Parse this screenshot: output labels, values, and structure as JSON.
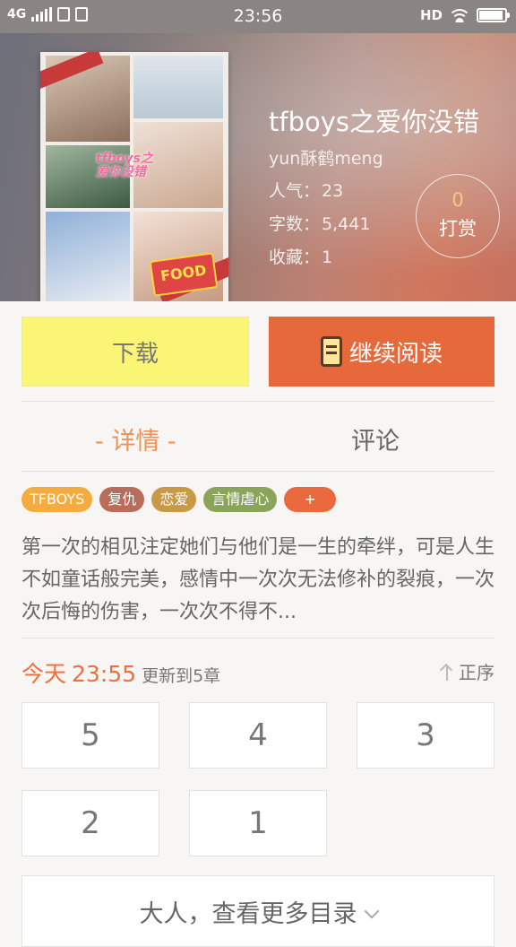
{
  "status_bar": {
    "network": "4G",
    "time": "23:56",
    "hd": "HD"
  },
  "book": {
    "title": "tfboys之爱你没错",
    "author": "yun酥鹤meng",
    "popularity_label": "人气：",
    "popularity": "23",
    "word_count_label": "字数：",
    "word_count": "5,441",
    "favorites_label": "收藏：",
    "favorites": "1",
    "cover_text": "tfboys之爱你没错",
    "cover_badge": "FOOD",
    "tip_count": "0",
    "tip_label": "打赏"
  },
  "actions": {
    "download": "下载",
    "continue_reading": "继续阅读"
  },
  "tabs": {
    "detail": "- 详情 -",
    "comments": "评论"
  },
  "tags": [
    {
      "label": "TFBOYS",
      "color": "#f5ab3e"
    },
    {
      "label": "复仇",
      "color": "#b86d5a"
    },
    {
      "label": "恋爱",
      "color": "#c89a45"
    },
    {
      "label": "言情虐心",
      "color": "#8aa55a"
    },
    {
      "label": "+",
      "color": "#e9683c"
    }
  ],
  "description": "第一次的相见注定她们与他们是一生的牵绊，可是人生不如童话般完美，感情中一次次无法修补的裂痕，一次次后悔的伤害，一次次不得不...",
  "update": {
    "day": "今天",
    "time": "23:55",
    "text": "更新到5章",
    "sort_label": "正序"
  },
  "chapters": [
    "5",
    "4",
    "3",
    "2",
    "1"
  ],
  "more_catalog": "大人，查看更多目录"
}
